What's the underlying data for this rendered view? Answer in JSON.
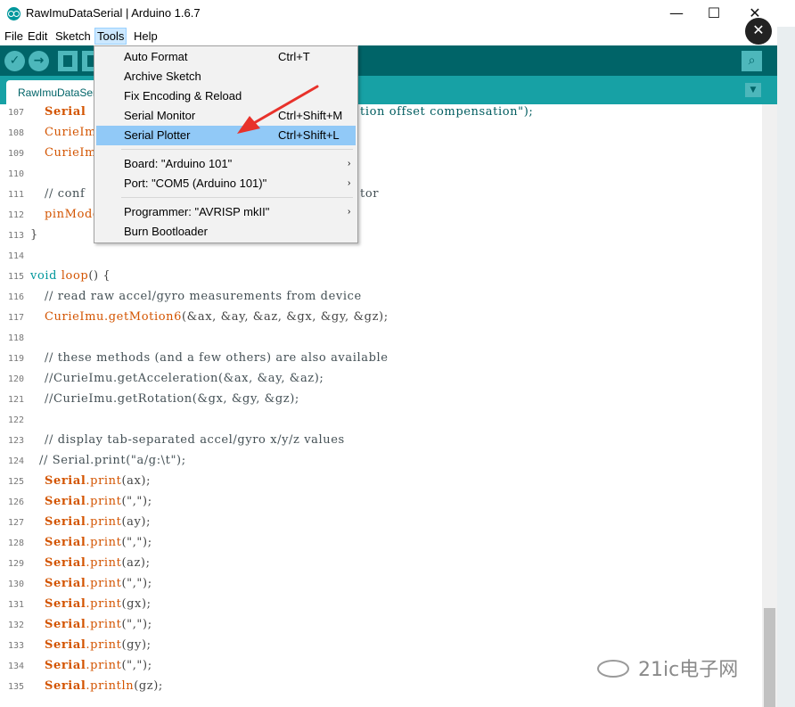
{
  "window": {
    "title": "RawImuDataSerial | Arduino 1.6.7",
    "minimize_glyph": "—",
    "maximize_glyph": "☐",
    "close_glyph": "✕"
  },
  "overlay_close_glyph": "✕",
  "menubar": [
    "File",
    "Edit",
    "Sketch",
    "Tools",
    "Help"
  ],
  "toolbar": {
    "verify_glyph": "✓",
    "upload_glyph": "→",
    "monitor_glyph": "⌕"
  },
  "tab": {
    "label": "RawImuDataSerial",
    "menu_glyph": "▼"
  },
  "tools_menu": {
    "items": [
      {
        "label": "Auto Format",
        "shortcut": "Ctrl+T"
      },
      {
        "label": "Archive Sketch",
        "shortcut": ""
      },
      {
        "label": "Fix Encoding & Reload",
        "shortcut": ""
      },
      {
        "label": "Serial Monitor",
        "shortcut": "Ctrl+Shift+M"
      },
      {
        "label": "Serial Plotter",
        "shortcut": "Ctrl+Shift+L"
      },
      {
        "label": "Board: \"Arduino 101\"",
        "shortcut": ""
      },
      {
        "label": "Port: \"COM5 (Arduino 101)\"",
        "shortcut": ""
      },
      {
        "label": "Programmer: \"AVRISP mkII\"",
        "shortcut": ""
      },
      {
        "label": "Burn Bootloader",
        "shortcut": ""
      }
    ],
    "selected": "Serial Plotter",
    "submenu_arrow": "›"
  },
  "code": {
    "line_numbers": [
      "107",
      "108",
      "109",
      "110",
      "111",
      "112",
      "113",
      "114",
      "115",
      "116",
      "117",
      "118",
      "119",
      "120",
      "121",
      "122",
      "123",
      "124",
      "125",
      "126",
      "127",
      "128",
      "129",
      "130",
      "131",
      "132",
      "133",
      "134",
      "135"
    ],
    "visible_fragments": {
      "l107_a": "Serial",
      "l107_b": "tion offset compensation\");",
      "l108": "CurieIm",
      "l109": "CurieIm",
      "l111_a": "// conf",
      "l111_b": "tor",
      "l112": "pinMode",
      "l113": "}"
    },
    "loop_keyword": "void",
    "loop_name": "loop",
    "loop_rest": "() {",
    "l116": "// read raw accel/gyro measurements from device",
    "l117_obj": "CurieImu.",
    "l117_fn": "getMotion6",
    "l117_args": "(&ax, &ay, &az, &gx, &gy, &gz);",
    "l119": "// these methods (and a few others) are also available",
    "l120": "//CurieImu.getAcceleration(&ax, &ay, &az);",
    "l121": "//CurieImu.getRotation(&gx, &gy, &gz);",
    "l123": "// display tab-separated accel/gyro x/y/z values",
    "l124": "// Serial.print(\"a/g:\\t\");",
    "print_lines": [
      {
        "obj": "Serial",
        "fn": ".print",
        "args": "(ax);"
      },
      {
        "obj": "Serial",
        "fn": ".print",
        "args": "(\",\");"
      },
      {
        "obj": "Serial",
        "fn": ".print",
        "args": "(ay);"
      },
      {
        "obj": "Serial",
        "fn": ".print",
        "args": "(\",\");"
      },
      {
        "obj": "Serial",
        "fn": ".print",
        "args": "(az);"
      },
      {
        "obj": "Serial",
        "fn": ".print",
        "args": "(\",\");"
      },
      {
        "obj": "Serial",
        "fn": ".print",
        "args": "(gx);"
      },
      {
        "obj": "Serial",
        "fn": ".print",
        "args": "(\",\");"
      },
      {
        "obj": "Serial",
        "fn": ".print",
        "args": "(gy);"
      },
      {
        "obj": "Serial",
        "fn": ".print",
        "args": "(\",\");"
      },
      {
        "obj": "Serial",
        "fn": ".println",
        "args": "(gz);"
      }
    ]
  },
  "watermark": {
    "text": "21ic电子网"
  },
  "colors": {
    "toolbar_bg": "#006468",
    "tab_bar_bg": "#17a1a5",
    "menu_highlight": "#91c9f7",
    "annotation_arrow": "#e8322b"
  }
}
